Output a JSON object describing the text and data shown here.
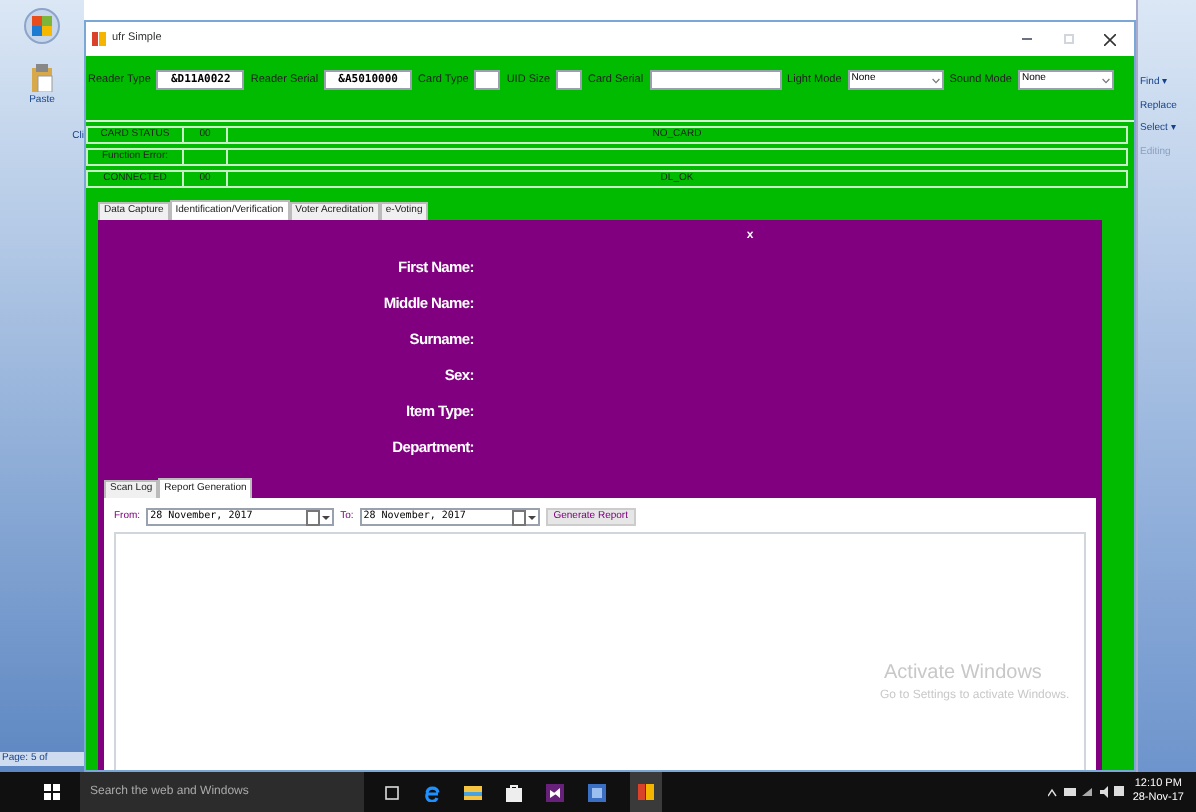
{
  "background_app": {
    "left": {
      "paste_label": "Paste",
      "group_label": "Cli",
      "page_status": "Page: 5 of"
    },
    "right": {
      "items": [
        "Find ▾",
        "Replace",
        "Select ▾"
      ],
      "group_label": "Editing"
    }
  },
  "window": {
    "title": "ufr Simple"
  },
  "toolbar": {
    "fields": [
      {
        "kind": "text",
        "label": "Reader Type",
        "value": "&D11A0022"
      },
      {
        "kind": "text",
        "label": "Reader Serial",
        "value": "&A5010000"
      },
      {
        "kind": "small",
        "label": "Card Type"
      },
      {
        "kind": "small",
        "label": "UID Size"
      },
      {
        "kind": "wide",
        "label": "Card Serial"
      },
      {
        "kind": "select",
        "label": "Light Mode",
        "value": "None"
      },
      {
        "kind": "select",
        "label": "Sound Mode",
        "value": "None"
      }
    ]
  },
  "status_rows": [
    {
      "name": "CARD STATUS",
      "code": "00",
      "message": "NO_CARD"
    },
    {
      "name": "Function Error:"
    },
    {
      "name": "CONNECTED",
      "code": "00",
      "message": "DL_OK"
    }
  ],
  "tabs": [
    {
      "label": "Data Capture",
      "selected": false
    },
    {
      "label": "Identification/Verification",
      "selected": true
    },
    {
      "label": "Voter Acreditation",
      "selected": false
    },
    {
      "label": "e-Voting",
      "selected": false
    }
  ],
  "identification": {
    "marker": "x",
    "fields": [
      "First Name:",
      "Middle Name:",
      "Surname:",
      "Sex:",
      "Item Type:",
      "Department:"
    ]
  },
  "subtabs": [
    {
      "label": "Scan Log",
      "selected": false
    },
    {
      "label": "Report Generation",
      "selected": true
    }
  ],
  "report": {
    "from_label": "From:",
    "from_date": "28 November, 2017",
    "to_label": "To:",
    "to_date": "28 November, 2017",
    "button": "Generate Report"
  },
  "activation_notice": {
    "title": "Activate Windows",
    "subtitle": "Go to Settings to activate Windows."
  },
  "taskbar": {
    "search_placeholder": "Search the web and Windows",
    "time": "12:10 PM",
    "date": "28-Nov-17"
  }
}
